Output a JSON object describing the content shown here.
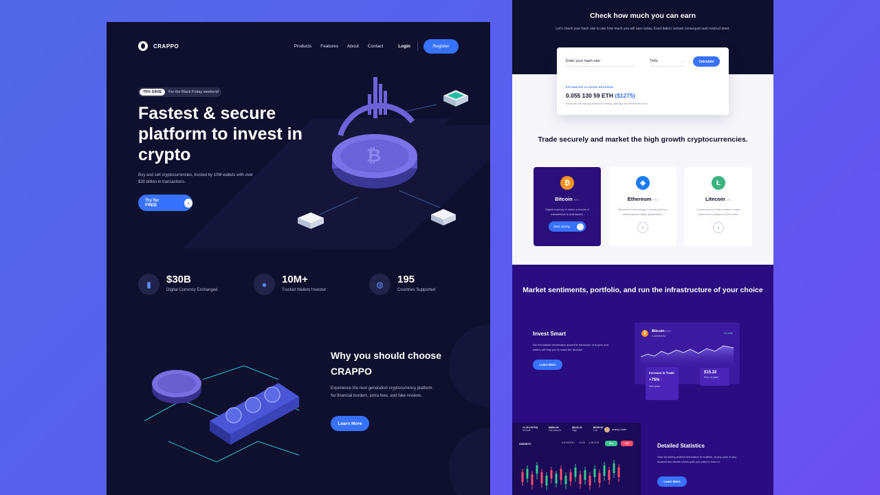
{
  "brand": {
    "name": "CRAPPO"
  },
  "nav": {
    "links": [
      "Products",
      "Features",
      "About",
      "Contact"
    ],
    "login": "Login",
    "register": "Register"
  },
  "hero": {
    "badge_pill": "75% SAVE",
    "badge_text": "For the Black Friday weekend",
    "title": "Fastest & secure platform to invest in crypto",
    "description": "Buy and sell cryptocurrencies, trusted by 10M wallets with over $30 billion in transactions.",
    "cta": "Try for FREE"
  },
  "stats": [
    {
      "value": "$30B",
      "label": "Digital Currency Exchanged",
      "icon": "chart-icon"
    },
    {
      "value": "10M+",
      "label": "Trusted Wallets Investor",
      "icon": "user-icon"
    },
    {
      "value": "195",
      "label": "Countries Supported",
      "icon": "globe-icon"
    }
  ],
  "why": {
    "title": "Why you should choose CRAPPO",
    "description": "Experience the next generation cryptocurrency platform. No financial borders, extra fees, and fake reviews.",
    "button": "Learn More"
  },
  "earn": {
    "title": "Check how much you can earn",
    "subtitle": "Let's check your hash rate to see how much you will earn today, Exercitation veniam consequat sunt nostrud amet.",
    "input_placeholder": "Enter your hash rate",
    "unit": "TH/s",
    "button": "Calculate",
    "estimate_label": "ESTIMATED 24 HOUR REVENUE",
    "estimate_value": "0.055 130 59 ETH",
    "estimate_usd": "($1275)",
    "note": "Revenue will change based on mining difficulty and Ethereum price."
  },
  "trade": {
    "title": "Trade securely and market the high growth cryptocurrencies.",
    "coins": [
      {
        "name": "Bitcoin",
        "ticker": "BTC",
        "desc": "Digital currency in which a record of transactions is maintained.",
        "button": "Start mining",
        "color": "#f7931a",
        "symbol": "₿"
      },
      {
        "name": "Ethereum",
        "ticker": "ETH",
        "desc": "Blockchain technology to create and run decentralized digital applications.",
        "color": "#1c7cf5",
        "symbol": "◆"
      },
      {
        "name": "Litecoin",
        "ticker": "LTC",
        "desc": "Cryptocurrency that enables instant payments to anyone in the world.",
        "color": "#3ab37c",
        "symbol": "Ł"
      }
    ]
  },
  "market": {
    "title": "Market sentiments, portfolio, and run the infrastructure of your choice",
    "invest_title": "Invest Smart",
    "invest_desc": "Get full statistic information about the behaviour of buyers and sellers will help you to make the decision.",
    "learn_more": "Learn More",
    "btc_card": {
      "name": "Bitcoin",
      "ticker": "BTC",
      "price": "0.00095 BTC",
      "change": "+1.25%",
      "increase_label": "Increase in Trade",
      "increase_value": "+75%",
      "sell_option": "Sell option",
      "dollar_value": "$15.32",
      "dollar_label": "Price in dollar"
    },
    "stats_title": "Detailed Statistics",
    "stats_desc": "View all mining related information in realtime, at any point at any location and decide which polls you want to mine in.",
    "trade_card": {
      "pair": "USD/BTC",
      "buy": "Buy",
      "sell": "Sell",
      "user": "Audrey Lewis",
      "figures": [
        "+1.25 (+5704)",
        "$6504.00",
        "$5123.21",
        "$6780.00"
      ],
      "sublabels": [
        "Volume",
        "24h volume",
        "High",
        "Low"
      ],
      "ohlc": [
        "0.0748 BTC",
        "+0.25",
        "0.25 ETH"
      ]
    }
  }
}
